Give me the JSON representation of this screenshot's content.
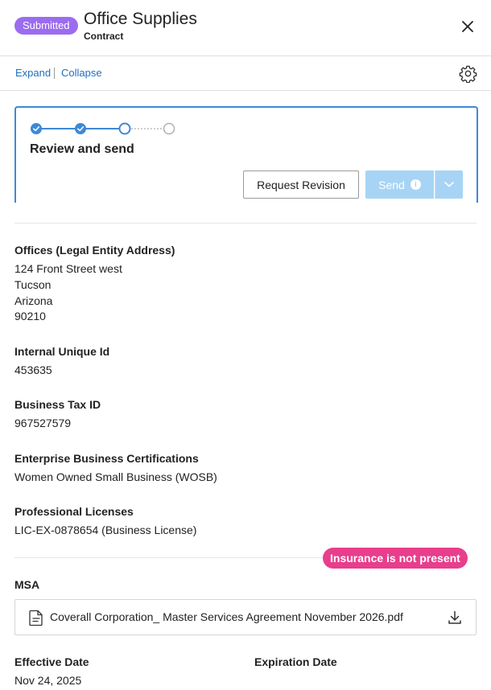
{
  "header": {
    "status_badge": "Submitted",
    "title": "Office Supplies",
    "subtitle": "Contract",
    "close_icon": "close-icon"
  },
  "toolbar": {
    "expand_label": "Expand",
    "collapse_label": "Collapse",
    "settings_icon": "gear-icon"
  },
  "workflow": {
    "steps": [
      {
        "state": "complete"
      },
      {
        "state": "complete"
      },
      {
        "state": "current"
      },
      {
        "state": "pending"
      }
    ],
    "step_title": "Review and send",
    "request_revision_label": "Request Revision",
    "send_label": "Send",
    "send_info_glyph": "i",
    "accent_color": "#3d89d6",
    "send_color": "#a7d4f4"
  },
  "details": {
    "offices": {
      "label": "Offices (Legal Entity Address)",
      "street": "124 Front Street west",
      "city": "Tucson",
      "state": "Arizona",
      "zip": "90210"
    },
    "internal_id": {
      "label": "Internal Unique Id",
      "value": "453635"
    },
    "tax_id": {
      "label": "Business Tax ID",
      "value": "967527579"
    },
    "certifications": {
      "label": "Enterprise Business Certifications",
      "value": "Women Owned Small Business (WOSB)"
    },
    "licenses": {
      "label": "Professional Licenses",
      "value": "LIC-EX-0878654 (Business License)"
    }
  },
  "insurance_warning": {
    "text": "Insurance is not present",
    "color": "#e83e8c"
  },
  "msa": {
    "label": "MSA",
    "file_name": "Coverall Corporation_ Master Services Agreement November 2026.pdf",
    "file_icon": "document-icon",
    "download_icon": "download-icon"
  },
  "dates": {
    "effective_label": "Effective Date",
    "effective_value": "Nov 24, 2025",
    "expiration_label": "Expiration Date"
  }
}
